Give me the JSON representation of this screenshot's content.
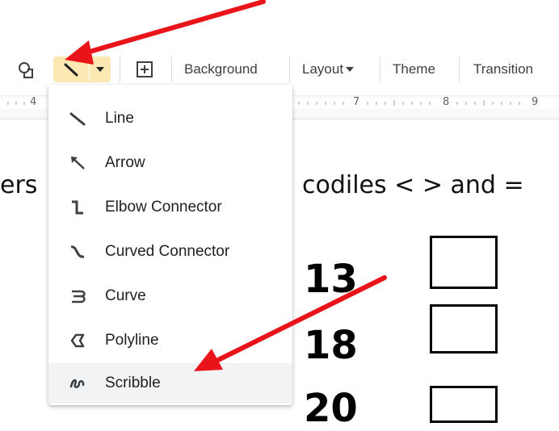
{
  "toolbar": {
    "background_label": "Background",
    "layout_label": "Layout",
    "theme_label": "Theme",
    "transition_label": "Transition",
    "icons": [
      "shapes-icon",
      "line-tool-icon",
      "dropdown-caret-icon",
      "new-slide-plus-icon",
      "layout-caret-icon"
    ]
  },
  "ruler": {
    "labels": [
      "4",
      "7",
      "8",
      "9"
    ]
  },
  "slide": {
    "left_text": "ers",
    "right_text": "codiles < > and =",
    "numbers": [
      "13",
      "18",
      "20"
    ]
  },
  "line_menu": {
    "items": [
      {
        "label": "Line",
        "icon": "line-icon"
      },
      {
        "label": "Arrow",
        "icon": "arrow-icon"
      },
      {
        "label": "Elbow Connector",
        "icon": "elbow-connector-icon"
      },
      {
        "label": "Curved Connector",
        "icon": "curved-connector-icon"
      },
      {
        "label": "Curve",
        "icon": "curve-icon"
      },
      {
        "label": "Polyline",
        "icon": "polyline-icon"
      },
      {
        "label": "Scribble",
        "icon": "scribble-icon"
      }
    ],
    "highlighted": "Scribble"
  },
  "colors": {
    "annotation_arrow": "#e8141a",
    "active_tool": "#fce8b2",
    "menu_hover": "#f1f3f4"
  }
}
